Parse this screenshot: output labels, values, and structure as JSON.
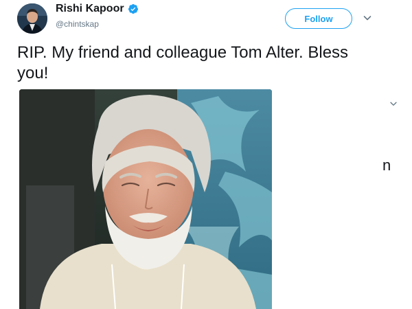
{
  "author": {
    "name": "Rishi Kapoor",
    "handle": "@chintskap",
    "verified": true
  },
  "follow_button": {
    "label": "Follow"
  },
  "tweet": {
    "text": "RIP. My friend and colleague Tom Alter. Bless you!"
  },
  "media": {
    "type": "photo"
  },
  "side_fragment": {
    "text": "n"
  },
  "icons": {
    "verified": "verified-badge-icon",
    "more_top": "chevron-down-icon",
    "more_side": "chevron-down-icon"
  },
  "colors": {
    "accent": "#1da1f2",
    "text": "#14171a",
    "muted": "#657786"
  }
}
